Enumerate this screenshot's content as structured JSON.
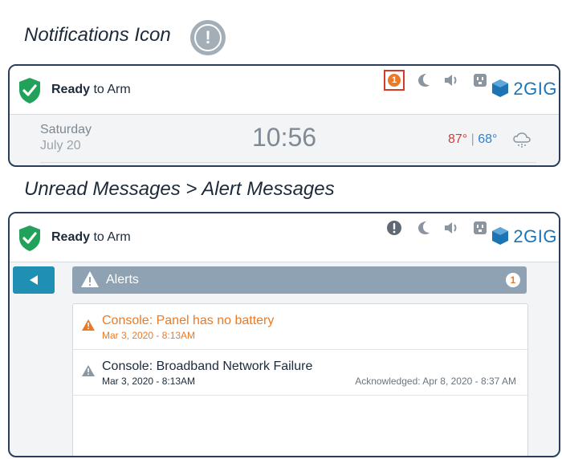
{
  "headings": {
    "notifications": "Notifications Icon",
    "unread": "Unread Messages > Alert Messages"
  },
  "panel1": {
    "status_bold": "Ready",
    "status_rest": " to Arm",
    "notification_count": "1",
    "brand": "2GIG",
    "day": "Saturday",
    "date": "July 20",
    "time": "10:56",
    "temp_high": "87°",
    "temp_sep": " | ",
    "temp_low": "68°"
  },
  "panel2": {
    "status_bold": "Ready",
    "status_rest": " to Arm",
    "brand": "2GIG",
    "alerts_label": "Alerts",
    "alerts_count": "1",
    "alerts": [
      {
        "title": "Console: Panel has no battery",
        "timestamp": "Mar 3, 2020 - 8:13AM",
        "acknowledged": ""
      },
      {
        "title": "Console: Broadband Network Failure",
        "timestamp": "Mar 3, 2020 - 8:13AM",
        "acknowledged": "Acknowledged: Apr 8, 2020 - 8:37 AM"
      }
    ]
  },
  "colors": {
    "accent": "#1f8fb3",
    "alert_orange": "#ea7a26",
    "shield_green": "#21a15a",
    "frame": "#2a3e5c",
    "highlight_red": "#d43b2a"
  },
  "icons": [
    "exclamation-icon",
    "shield-check-icon",
    "moon-icon",
    "speaker-icon",
    "outlet-icon",
    "brand-cube-icon",
    "cloud-snow-icon",
    "back-arrow-icon",
    "warning-icon"
  ]
}
